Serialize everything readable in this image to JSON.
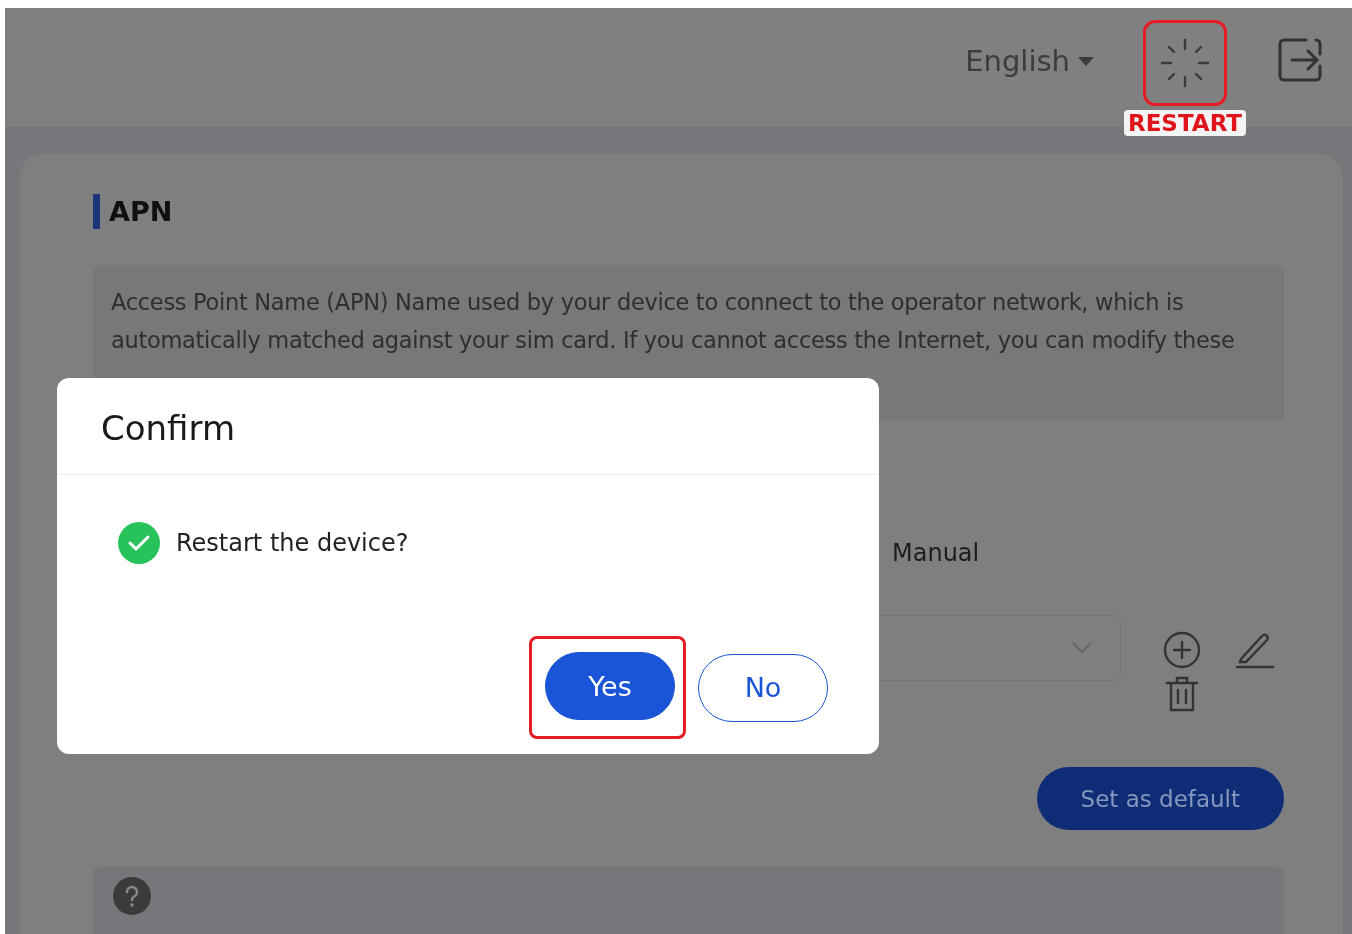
{
  "header": {
    "language": "English",
    "restart_label": "RESTART"
  },
  "section": {
    "title": "APN",
    "description": "Access Point Name (APN) Name used by your device to connect to the operator network, which is automatically matched against your sim card. If you cannot access the Internet, you can modify these",
    "mode_option": "Manual",
    "default_button": "Set as default"
  },
  "dialog": {
    "title": "Confirm",
    "message": "Restart the device?",
    "buttons": [
      {
        "label": "Yes",
        "kind": "primary"
      },
      {
        "label": "No",
        "kind": "secondary"
      }
    ]
  }
}
